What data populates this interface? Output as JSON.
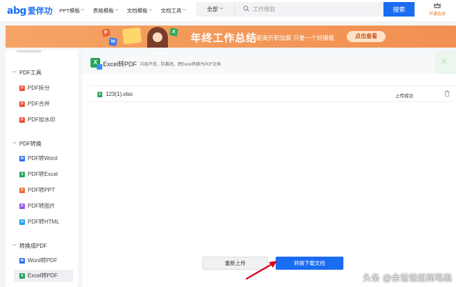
{
  "header": {
    "logo_mark": "abg",
    "logo_text": "爱伴功",
    "nav": [
      "PPT模板",
      "表格模板",
      "文档模板",
      "文档工具"
    ],
    "search": {
      "category": "全部",
      "placeholder": "工作规划",
      "button": "搜索"
    },
    "member_label": "开通会员"
  },
  "banner": {
    "title": "年终工作总结",
    "subtitle": "距离升职加薪 只差一个好模板",
    "button": "点击查看",
    "icons": {
      "ppt": "P",
      "xls": "X",
      "doc": "W"
    }
  },
  "sidebar": {
    "groups": [
      {
        "label": "PDF工具",
        "items": [
          {
            "label": "PDF拆分",
            "icon": "pdf",
            "glyph": "P"
          },
          {
            "label": "PDF合并",
            "icon": "pdf",
            "glyph": "P"
          },
          {
            "label": "PDF加水印",
            "icon": "pdf",
            "glyph": "P"
          }
        ]
      },
      {
        "label": "PDF转换",
        "items": [
          {
            "label": "PDF转Word",
            "icon": "word",
            "glyph": "W"
          },
          {
            "label": "PDF转Excel",
            "icon": "xls",
            "glyph": "X"
          },
          {
            "label": "PDF转PPT",
            "icon": "ppt",
            "glyph": "P"
          },
          {
            "label": "PDF转图片",
            "icon": "img",
            "glyph": "P"
          },
          {
            "label": "PDF转HTML",
            "icon": "html",
            "glyph": "H"
          }
        ]
      },
      {
        "label": "转换成PDF",
        "items": [
          {
            "label": "Word转PDF",
            "icon": "word",
            "glyph": "W"
          },
          {
            "label": "Excel转PDF",
            "icon": "xls",
            "glyph": "X",
            "active": true
          }
        ]
      }
    ]
  },
  "main": {
    "tool_icon": "X",
    "title": "Excel转PDF",
    "description": "内容不变、防篡改，把Excel转换为PDF文档",
    "files": [
      {
        "icon": "X",
        "name": "123(1).xlsx",
        "status": "上传成功"
      }
    ],
    "buttons": {
      "reupload": "重新上传",
      "download": "转换下载文档"
    }
  },
  "watermark": "头条 @余爸爸姐简笔画",
  "colors": {
    "primary": "#1a6cf2",
    "banner": "#f39a5a",
    "excel_green": "#22a65a",
    "pdf_red": "#e8533c"
  }
}
